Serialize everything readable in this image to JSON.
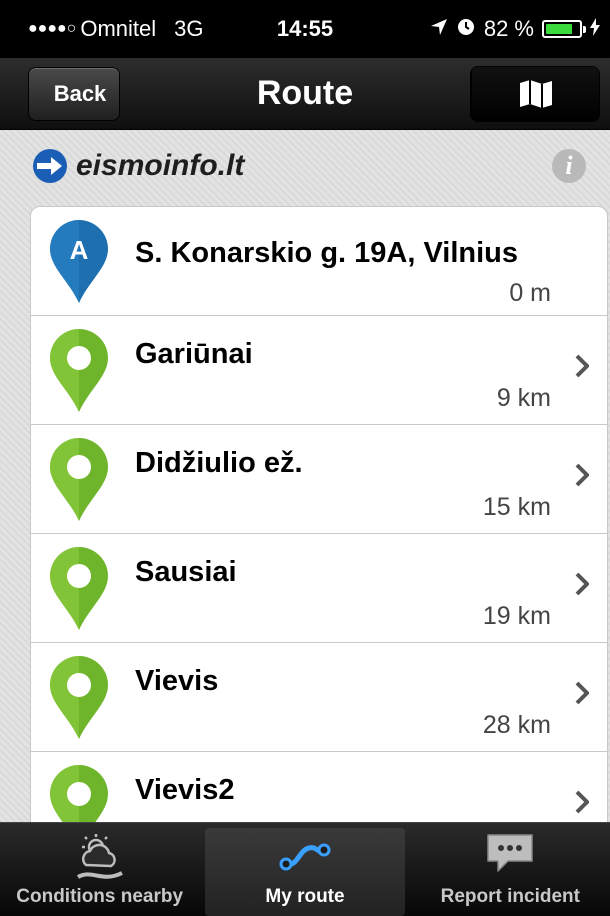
{
  "status_bar": {
    "signal": "●●●●○",
    "carrier": "Omnitel",
    "network": "3G",
    "time": "14:55",
    "battery": "82 %",
    "battery_level": 0.82
  },
  "nav": {
    "back_label": "Back",
    "title": "Route"
  },
  "brand": {
    "name": "eismoinfo.lt",
    "info_symbol": "i"
  },
  "route": {
    "stops": [
      {
        "marker": "A",
        "name": "S. Konarskio g. 19A, Vilnius",
        "distance": "0 m"
      },
      {
        "marker": "",
        "name": "Gariūnai",
        "distance": "9 km"
      },
      {
        "marker": "",
        "name": "Didžiulio ež.",
        "distance": "15 km"
      },
      {
        "marker": "",
        "name": "Sausiai",
        "distance": "19 km"
      },
      {
        "marker": "",
        "name": "Vievis",
        "distance": "28 km"
      },
      {
        "marker": "",
        "name": "Vievis2",
        "distance": ""
      }
    ]
  },
  "tabs": [
    {
      "label": "Conditions nearby",
      "icon": "weather-icon"
    },
    {
      "label": "My route",
      "icon": "route-icon"
    },
    {
      "label": "Report incident",
      "icon": "chat-bubble-icon"
    }
  ],
  "colors": {
    "start_pin": "#1d6fb0",
    "stop_pin": "#6fb52c",
    "route_icon": "#3aa0ff"
  }
}
